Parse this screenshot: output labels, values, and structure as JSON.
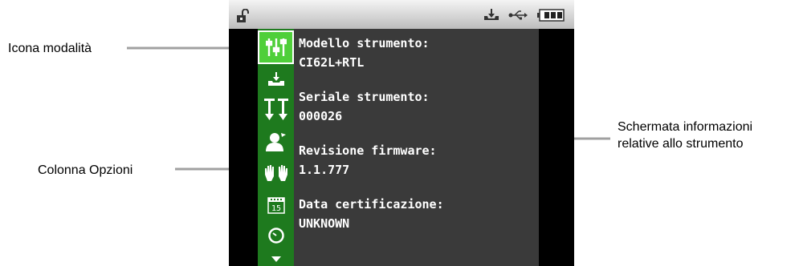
{
  "callouts": {
    "mode_icon": "Icona modalità",
    "options_column": "Colonna Opzioni",
    "info_screen_line1": "Schermata informazioni",
    "info_screen_line2": "relative allo strumento"
  },
  "status_bar": {
    "icons": [
      "unlock-icon",
      "tray-icon",
      "usb-icon",
      "battery-icon"
    ]
  },
  "options_column": {
    "items": [
      {
        "icon": "sliders-icon",
        "selected": true
      },
      {
        "icon": "tray-icon",
        "selected": false
      },
      {
        "icon": "arrows-icon",
        "selected": false
      },
      {
        "icon": "user-icon",
        "selected": false
      },
      {
        "icon": "hands-icon",
        "selected": false
      },
      {
        "icon": "calendar-icon",
        "selected": false,
        "text": "15"
      },
      {
        "icon": "clock-icon",
        "selected": false
      },
      {
        "icon": "chevron-down-icon",
        "selected": false
      }
    ]
  },
  "info": {
    "model_label": "Modello strumento:",
    "model_value": "CI62L+RTL",
    "serial_label": "Seriale strumento:",
    "serial_value": "000026",
    "firmware_label": "Revisione firmware:",
    "firmware_value": "1.1.777",
    "cert_label": "Data certificazione:",
    "cert_value": "UNKNOWN"
  },
  "colors": {
    "option_column": "#1e7a1e",
    "option_selected": "#4fcf3a",
    "panel": "#3a3a3a",
    "arrow": "#a0a0a0"
  }
}
